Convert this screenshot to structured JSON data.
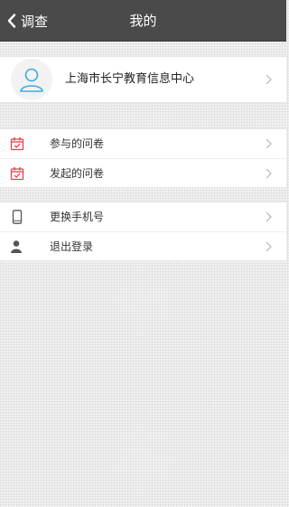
{
  "nav": {
    "back_label": "调查",
    "title": "我的"
  },
  "profile": {
    "name": "上海市长宁教育信息中心"
  },
  "menu": {
    "group1": [
      {
        "label": "参与的问卷",
        "icon": "calendar-check-icon"
      },
      {
        "label": "发起的问卷",
        "icon": "calendar-check-icon"
      }
    ],
    "group2": [
      {
        "label": "更换手机号",
        "icon": "phone-icon"
      },
      {
        "label": "退出登录",
        "icon": "user-icon"
      }
    ]
  },
  "colors": {
    "navbar": "#4a4a4a",
    "accent_red": "#e0454b",
    "avatar_blue": "#3fa9e0",
    "icon_gray": "#555555"
  }
}
